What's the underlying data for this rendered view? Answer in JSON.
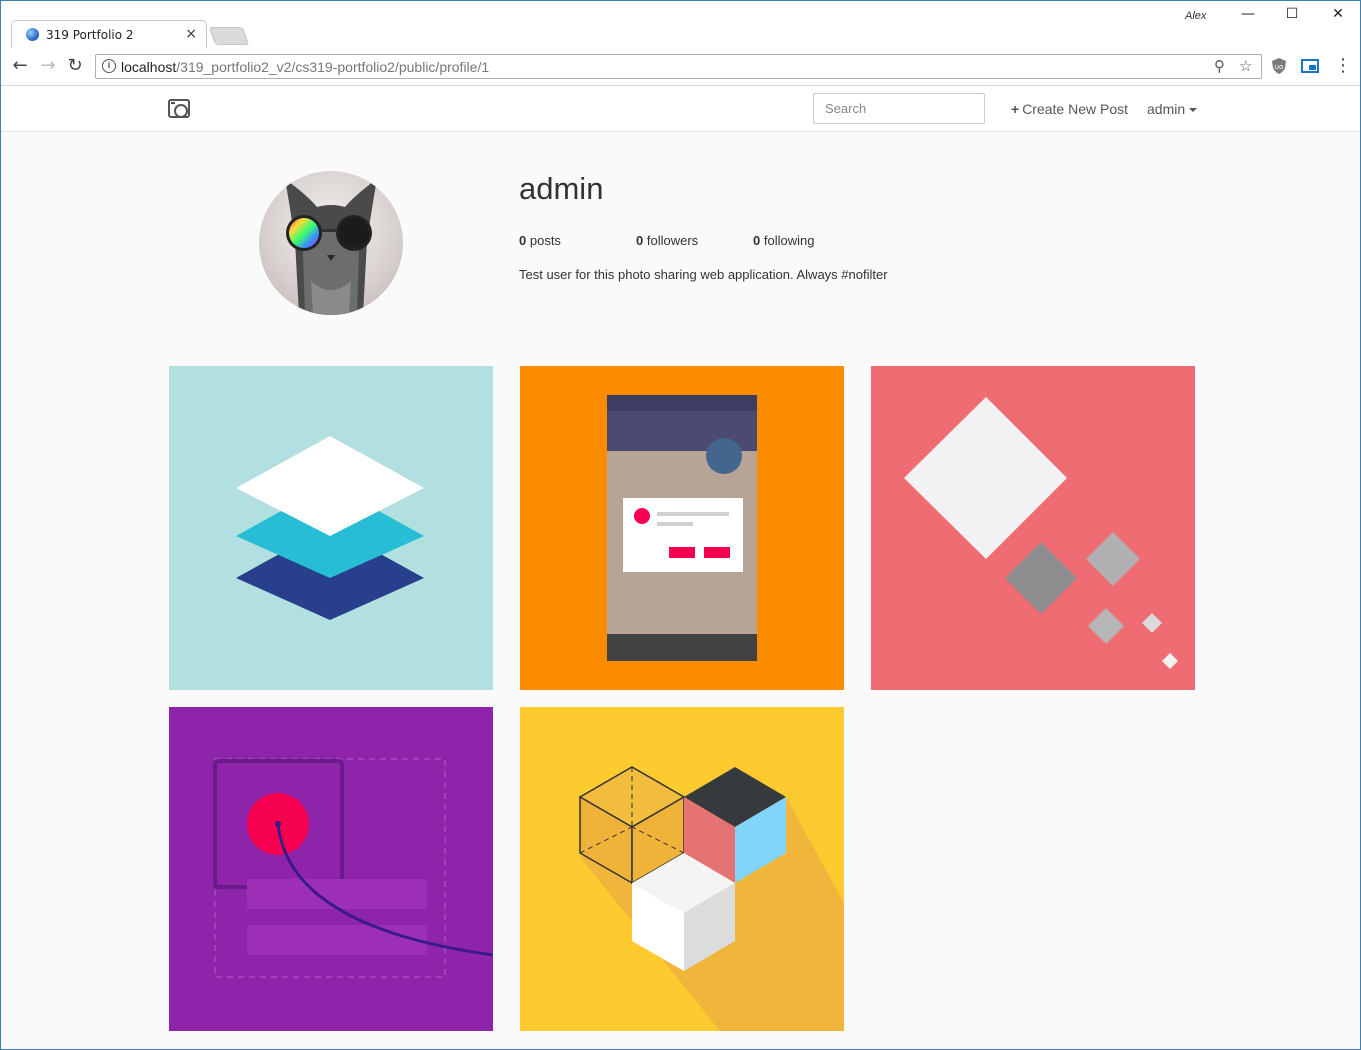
{
  "browser": {
    "tab_title": "319 Portfolio 2",
    "tab_close": "×",
    "window_user": "Alex",
    "window_controls": {
      "minimize": "—",
      "maximize": "☐",
      "close": "✕"
    },
    "url_host": "localhost",
    "url_path": "/319_portfolio2_v2/cs319-portfolio2/public/profile/1",
    "icons": {
      "back": "back-arrow-icon",
      "forward": "forward-arrow-icon",
      "reload": "reload-icon",
      "zoom": "zoom-icon",
      "bookmark": "star-icon",
      "menu": "kebab-menu-icon"
    }
  },
  "navbar": {
    "brand_icon": "camera-icon",
    "search_placeholder": "Search",
    "create_post_label": "Create New Post",
    "user_menu_label": "admin"
  },
  "profile": {
    "username": "admin",
    "stats": [
      {
        "count": "0",
        "label": "posts"
      },
      {
        "count": "0",
        "label": "followers"
      },
      {
        "count": "0",
        "label": "following"
      }
    ],
    "bio": "Test user for this photo sharing web application. Always #nofilter"
  },
  "posts": [
    {
      "image": "layers-illustration",
      "background": "#b2dfdf"
    },
    {
      "image": "mobile-dialog-illustration",
      "background": "#fb8c00"
    },
    {
      "image": "diamonds-illustration",
      "background": "#ef6c73"
    },
    {
      "image": "motion-path-illustration",
      "background": "#8e24aa"
    },
    {
      "image": "cubes-illustration",
      "background": "#fdca2f"
    }
  ]
}
